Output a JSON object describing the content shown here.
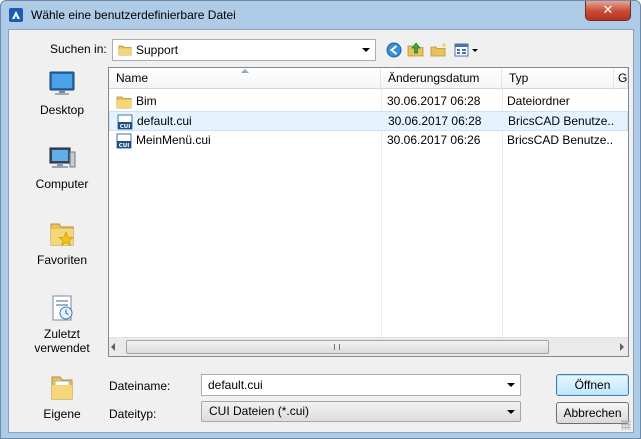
{
  "window": {
    "title": "Wähle eine benutzerdefinierbare Datei",
    "close_glyph": "✕",
    "app_icon": "bricscad-icon"
  },
  "lookin": {
    "label": "Suchen in:",
    "value": "Support"
  },
  "toolbar": {
    "icons": [
      "back-icon",
      "up-folder-icon",
      "new-folder-icon",
      "view-menu-icon"
    ]
  },
  "places": [
    {
      "label": "Desktop",
      "icon": "desktop-icon"
    },
    {
      "label": "Computer",
      "icon": "computer-icon"
    },
    {
      "label": "Favoriten",
      "icon": "favorites-icon"
    },
    {
      "label": "Zuletzt verwendet",
      "icon": "recent-icon"
    },
    {
      "label": "Eigene",
      "icon": "documents-icon"
    }
  ],
  "filelist": {
    "columns": [
      "Name",
      "Änderungsdatum",
      "Typ",
      "G"
    ],
    "rows": [
      {
        "name": "Bim",
        "date": "30.06.2017 06:28",
        "type": "Dateiordner",
        "icon": "folder-icon",
        "selected": false
      },
      {
        "name": "default.cui",
        "date": "30.06.2017 06:28",
        "type": "BricsCAD Benutze...",
        "icon": "cui-file-icon",
        "selected": true
      },
      {
        "name": "MeinMenü.cui",
        "date": "30.06.2017 06:26",
        "type": "BricsCAD Benutze...",
        "icon": "cui-file-icon",
        "selected": false
      }
    ]
  },
  "filename": {
    "label": "Dateiname:",
    "value": "default.cui"
  },
  "filetype": {
    "label": "Dateityp:",
    "value": "CUI Dateien (*.cui)"
  },
  "buttons": {
    "open": "Öffnen",
    "cancel": "Abbrechen"
  },
  "colors": {
    "accent": "#3c7fb1",
    "selection": "#e5f3ff",
    "frame": "#aecbe8"
  }
}
